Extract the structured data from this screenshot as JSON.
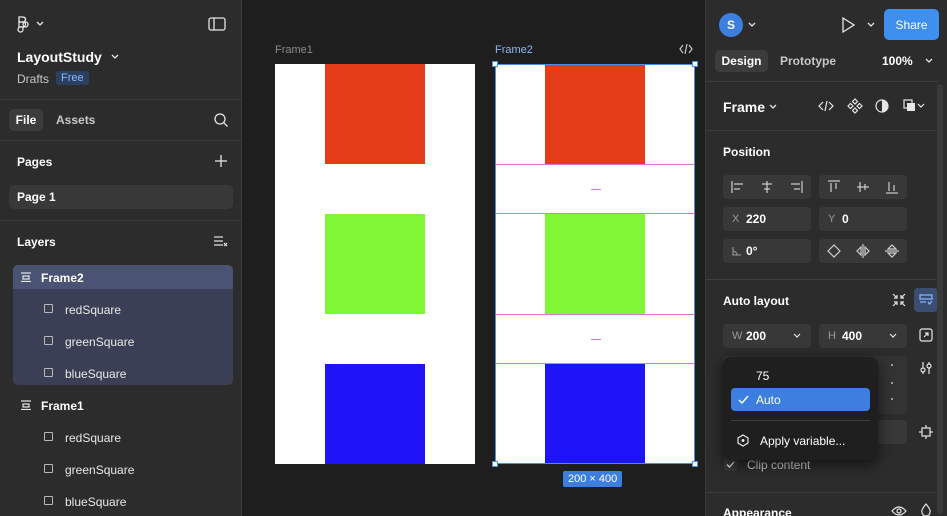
{
  "left_panel": {
    "file_name": "LayoutStudy",
    "location": "Drafts",
    "plan_badge": "Free",
    "tabs": [
      "File",
      "Assets"
    ],
    "pages_title": "Pages",
    "pages": [
      "Page 1"
    ],
    "layers_title": "Layers",
    "layers": [
      {
        "name": "Frame2",
        "children": [
          "redSquare",
          "greenSquare",
          "blueSquare"
        ]
      },
      {
        "name": "Frame1",
        "children": [
          "redSquare",
          "greenSquare",
          "blueSquare"
        ]
      }
    ]
  },
  "canvas": {
    "frames": [
      {
        "label": "Frame1"
      },
      {
        "label": "Frame2"
      }
    ],
    "size_badge": "200 × 400",
    "colors": {
      "red": "#e53c1a",
      "green": "#80f734",
      "blue": "#1f13f7",
      "gap": "#d977d3",
      "selection": "#4a8fe8"
    }
  },
  "right_panel": {
    "avatar_initial": "S",
    "share_label": "Share",
    "tabs": [
      "Design",
      "Prototype"
    ],
    "zoom": "100%",
    "frame_selector": "Frame",
    "position_title": "Position",
    "x_label": "X",
    "x_value": "220",
    "y_label": "Y",
    "y_value": "0",
    "rotation_value": "0°",
    "auto_layout_title": "Auto layout",
    "w_label": "W",
    "w_value": "200",
    "h_label": "H",
    "h_value": "400",
    "clip_content": "Clip content",
    "appearance_title": "Appearance"
  },
  "dropdown": {
    "options": [
      "75",
      "Auto"
    ],
    "selected": "Auto",
    "apply_variable": "Apply variable..."
  }
}
